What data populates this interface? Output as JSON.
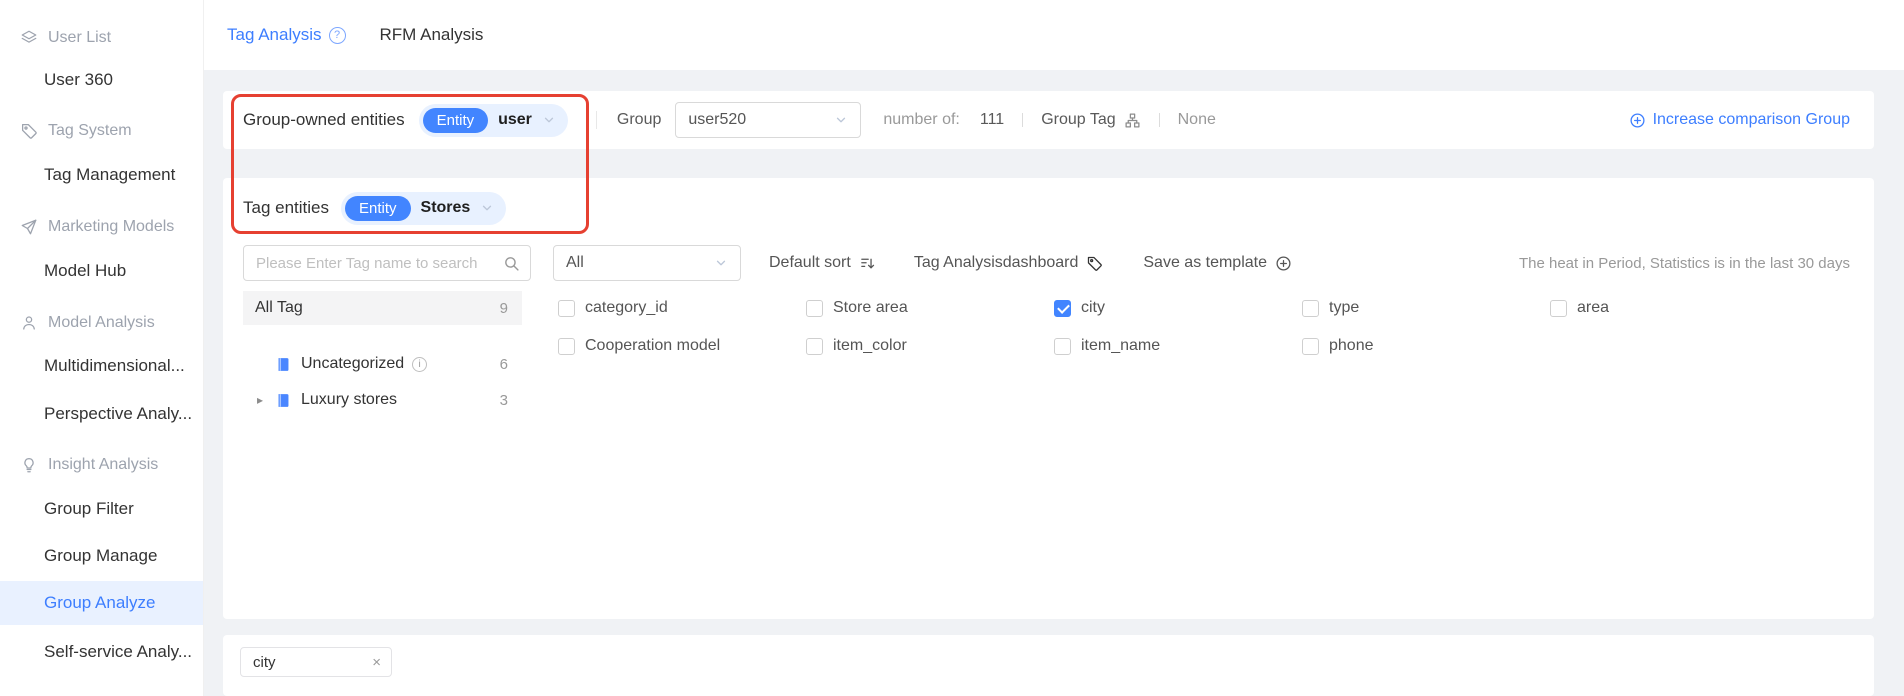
{
  "colors": {
    "primary": "#3D7EFF",
    "entity_pill": "#4285FF",
    "annotation_red": "#E64031",
    "content_bg": "#F0F2F5"
  },
  "glyphs": {
    "help_q": "?",
    "close_x": "×",
    "caret": "▸",
    "info_i": "i"
  },
  "sidebar": {
    "rows": [
      {
        "type": "header",
        "icon": "layers-icon",
        "label": "User List"
      },
      {
        "type": "item",
        "label": "User 360"
      },
      {
        "type": "header",
        "icon": "tag-icon",
        "label": "Tag System"
      },
      {
        "type": "item",
        "label": "Tag Management"
      },
      {
        "type": "header",
        "icon": "send-icon",
        "label": "Marketing Models"
      },
      {
        "type": "item",
        "label": "Model Hub"
      },
      {
        "type": "header",
        "icon": "person-icon",
        "label": "Model Analysis"
      },
      {
        "type": "item",
        "label": "Multidimensional..."
      },
      {
        "type": "item",
        "label": "Perspective Analy..."
      },
      {
        "type": "header",
        "icon": "bulb-icon",
        "label": "Insight Analysis"
      },
      {
        "type": "item",
        "label": "Group Filter"
      },
      {
        "type": "item",
        "label": "Group Manage"
      },
      {
        "type": "item",
        "label": "Group Analyze",
        "active": true
      },
      {
        "type": "item",
        "label": "Self-service Analy..."
      }
    ]
  },
  "tabs": {
    "tag_analysis": "Tag Analysis",
    "rfm_analysis": "RFM Analysis"
  },
  "filters": {
    "group_owned_label": "Group-owned entities",
    "entity_badge": "Entity",
    "group_owned_value": "user",
    "group_label": "Group",
    "group_value": "user520",
    "number_of_label": "number of:",
    "number_of_value": "111",
    "group_tag_label": "Group Tag",
    "none_value": "None",
    "increase_link": "Increase comparison Group",
    "tag_entities_label": "Tag entities",
    "tag_entities_value": "Stores"
  },
  "toolbar": {
    "search_placeholder": "Please Enter Tag name to search",
    "category_value": "All",
    "sort_label": "Default sort",
    "dashboard_label": "Tag Analysisdashboard",
    "template_label": "Save as template",
    "period_note": "The heat in Period, Statistics is in the last 30 days"
  },
  "tag_tree": {
    "all_label": "All Tag",
    "all_count": "9",
    "items": [
      {
        "label": "Uncategorized",
        "count": "6",
        "has_info": true
      },
      {
        "label": "Luxury stores",
        "count": "3",
        "expandable": true
      }
    ]
  },
  "tags": [
    {
      "label": "category_id",
      "checked": false
    },
    {
      "label": "Store area",
      "checked": false
    },
    {
      "label": "city",
      "checked": true
    },
    {
      "label": "type",
      "checked": false
    },
    {
      "label": "area",
      "checked": false
    },
    {
      "label": "Cooperation model",
      "checked": false
    },
    {
      "label": "item_color",
      "checked": false
    },
    {
      "label": "item_name",
      "checked": false
    },
    {
      "label": "phone",
      "checked": false
    }
  ],
  "selected_tags": [
    {
      "label": "city"
    }
  ]
}
